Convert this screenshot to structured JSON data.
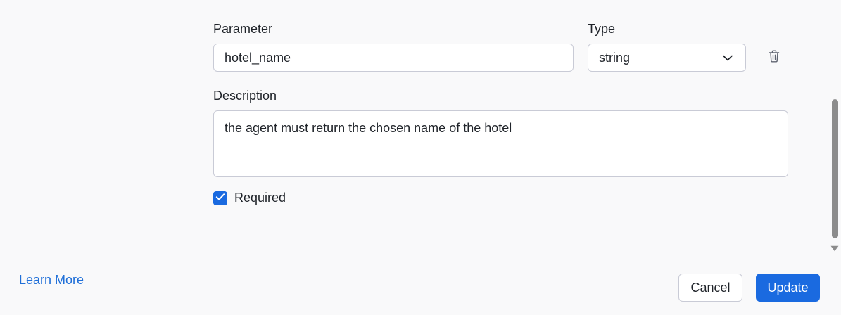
{
  "form": {
    "parameter_label": "Parameter",
    "parameter_value": "hotel_name",
    "type_label": "Type",
    "type_value": "string",
    "description_label": "Description",
    "description_value": "the agent must return the chosen name of the hotel",
    "required_label": "Required",
    "required_checked": true
  },
  "footer": {
    "learn_more": "Learn More",
    "cancel_label": "Cancel",
    "update_label": "Update"
  },
  "icons": {
    "type_dropdown": "chevron-down-icon",
    "delete": "trash-icon",
    "checkbox": "check-icon",
    "scroll_down": "triangle-down-icon"
  },
  "colors": {
    "accent": "#1a6ae0",
    "link": "#1f6fd8",
    "border": "#c9cbd6",
    "background": "#f9f9fa"
  }
}
